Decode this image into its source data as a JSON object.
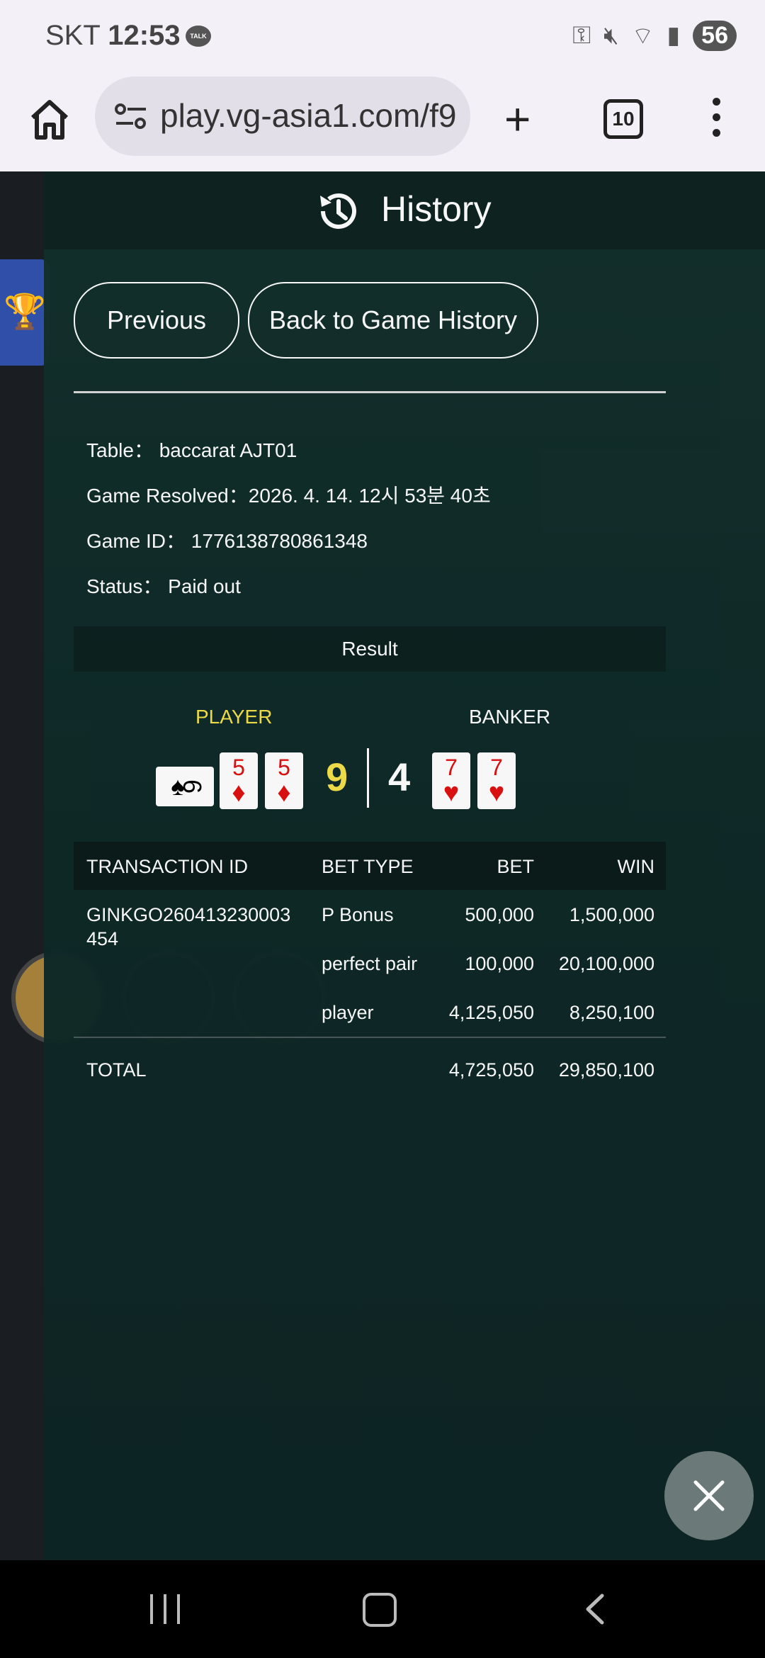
{
  "status_bar": {
    "carrier": "SKT",
    "time": "12:53",
    "battery": "56"
  },
  "browser": {
    "url": "play.vg-asia1.com/f9",
    "tab_count": "10"
  },
  "history": {
    "title": "History",
    "previous_label": "Previous",
    "back_label": "Back to Game History",
    "info": {
      "table": "Table： baccarat AJT01",
      "resolved": "Game Resolved：2026. 4. 14. 12시 53분 40초",
      "game_id": "Game ID： 1776138780861348",
      "status": "Status： Paid out"
    },
    "result_label": "Result",
    "player_label": "PLAYER",
    "banker_label": "BANKER",
    "player_cards": [
      {
        "rank": "6",
        "suit": "♠",
        "color": "#000000",
        "sideways": true
      },
      {
        "rank": "5",
        "suit": "♦",
        "color": "#e01010"
      },
      {
        "rank": "5",
        "suit": "♦",
        "color": "#e01010"
      }
    ],
    "banker_cards": [
      {
        "rank": "7",
        "suit": "♥",
        "color": "#e01010"
      },
      {
        "rank": "7",
        "suit": "♥",
        "color": "#e01010"
      }
    ],
    "player_score": "9",
    "banker_score": "4",
    "table_headers": {
      "transaction_id": "TRANSACTION ID",
      "bet_type": "BET TYPE",
      "bet": "BET",
      "win": "WIN"
    },
    "transaction_id": "GINKGO260413230003454",
    "transaction_id_line1": "GINKGO260413230003",
    "transaction_id_line2": "454",
    "rows": [
      {
        "bet_type": "P Bonus",
        "bet": "500,000",
        "win": "1,500,000"
      },
      {
        "bet_type": "perfect pair",
        "bet": "100,000",
        "win": "20,100,000"
      },
      {
        "bet_type": "player",
        "bet": "4,125,050",
        "win": "8,250,100"
      }
    ],
    "total": {
      "label": "TOTAL",
      "bet": "4,725,050",
      "win": "29,850,100"
    }
  },
  "colors": {
    "player_yellow": "#f4e04a",
    "card_red": "#e01010",
    "overlay_bg": "#0f2a28"
  }
}
